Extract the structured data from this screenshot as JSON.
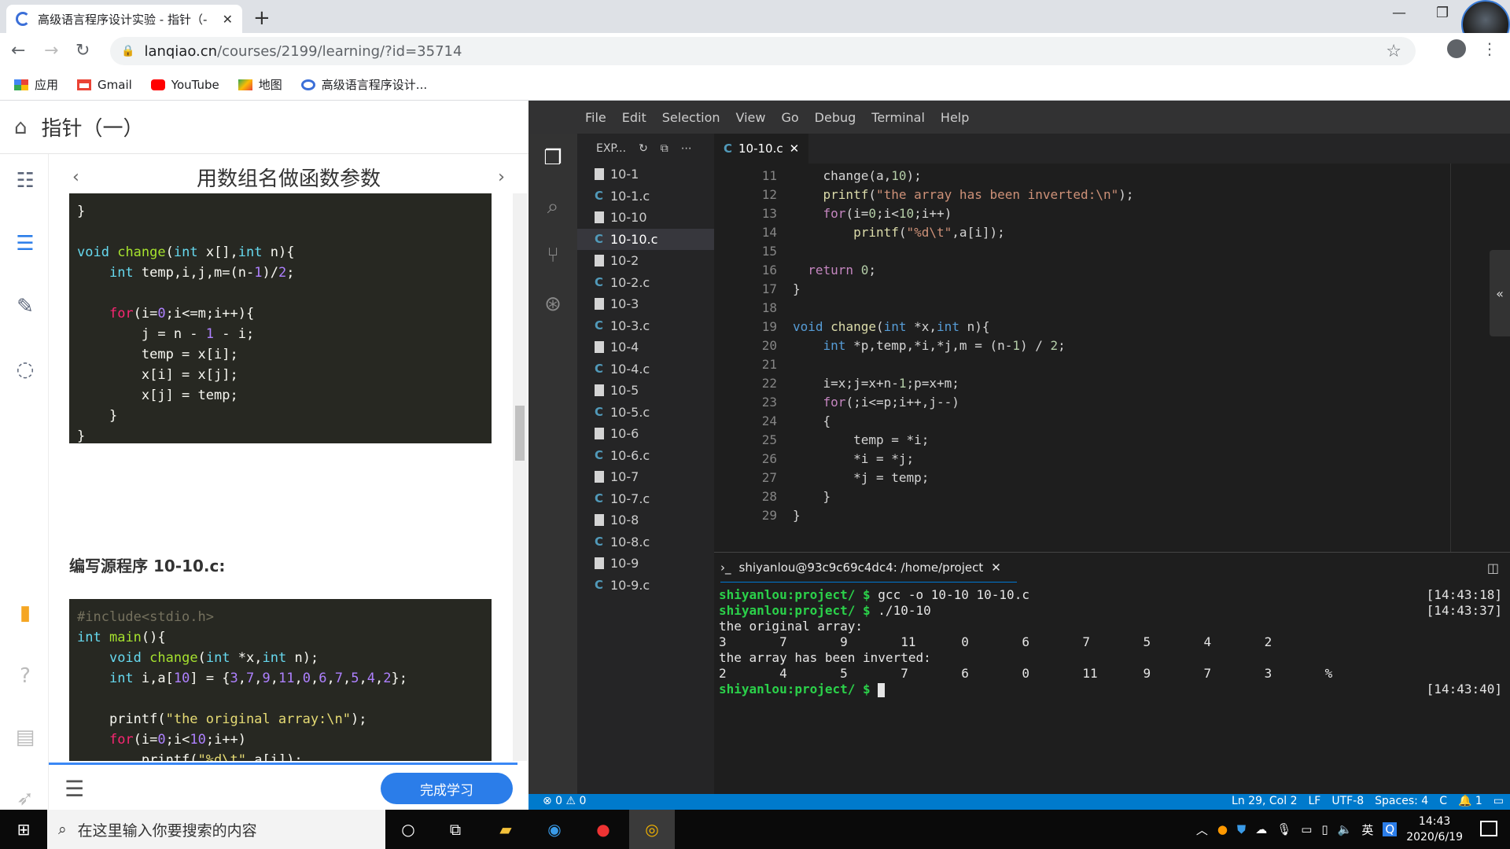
{
  "browser": {
    "tab_title": "高级语言程序设计实验 - 指针（-",
    "address_host": "lanqiao.cn",
    "address_path": "/courses/2199/learning/?id=35714",
    "bookmarks": [
      "应用",
      "Gmail",
      "YouTube",
      "地图",
      "高级语言程序设计..."
    ]
  },
  "course": {
    "title": "指针（一）",
    "lesson_title": "用数组名做函数参数",
    "section_heading": "编写源程序 10-10.c:",
    "finish_button": "完成学习"
  },
  "vscode": {
    "menu": [
      "File",
      "Edit",
      "Selection",
      "View",
      "Go",
      "Debug",
      "Terminal",
      "Help"
    ],
    "explorer_label": "EXP...",
    "files": [
      {
        "name": "10-1",
        "type": "plain"
      },
      {
        "name": "10-1.c",
        "type": "c"
      },
      {
        "name": "10-10",
        "type": "plain"
      },
      {
        "name": "10-10.c",
        "type": "c"
      },
      {
        "name": "10-2",
        "type": "plain"
      },
      {
        "name": "10-2.c",
        "type": "c"
      },
      {
        "name": "10-3",
        "type": "plain"
      },
      {
        "name": "10-3.c",
        "type": "c"
      },
      {
        "name": "10-4",
        "type": "plain"
      },
      {
        "name": "10-4.c",
        "type": "c"
      },
      {
        "name": "10-5",
        "type": "plain"
      },
      {
        "name": "10-5.c",
        "type": "c"
      },
      {
        "name": "10-6",
        "type": "plain"
      },
      {
        "name": "10-6.c",
        "type": "c"
      },
      {
        "name": "10-7",
        "type": "plain"
      },
      {
        "name": "10-7.c",
        "type": "c"
      },
      {
        "name": "10-8",
        "type": "plain"
      },
      {
        "name": "10-8.c",
        "type": "c"
      },
      {
        "name": "10-9",
        "type": "plain"
      },
      {
        "name": "10-9.c",
        "type": "c"
      }
    ],
    "active_file": "10-10.c",
    "editor_tab": "10-10.c",
    "terminal_title": "shiyanlou@93c9c69c4dc4: /home/project",
    "terminal_lines": [
      {
        "text": "",
        "prompt": "shiyanlou:project/ $ ",
        "cmd": "gcc -o 10-10 10-10.c",
        "time": "[14:43:18]"
      },
      {
        "text": "",
        "prompt": "shiyanlou:project/ $ ",
        "cmd": "./10-10",
        "time": "[14:43:37]"
      },
      {
        "text": "the original array:",
        "prompt": "",
        "cmd": "",
        "time": ""
      },
      {
        "text": "3       7       9       11      0       6       7       5       4       2",
        "prompt": "",
        "cmd": "",
        "time": ""
      },
      {
        "text": "the array has been inverted:",
        "prompt": "",
        "cmd": "",
        "time": ""
      },
      {
        "text": "2       4       5       7       6       0       11      9       7       3       %",
        "prompt": "",
        "cmd": "",
        "time": ""
      },
      {
        "text": "",
        "prompt": "shiyanlou:project/ $ ",
        "cmd": "",
        "time": "[14:43:40]"
      }
    ],
    "status_left": "⊗ 0 ⚠ 0",
    "status_right": [
      "Ln 29, Col 2",
      "LF",
      "UTF-8",
      "Spaces: 4",
      "C",
      "🔔 1"
    ]
  },
  "taskbar": {
    "search_placeholder": "在这里输入你要搜索的内容",
    "time": "14:43",
    "date": "2020/6/19",
    "ime": "英"
  }
}
